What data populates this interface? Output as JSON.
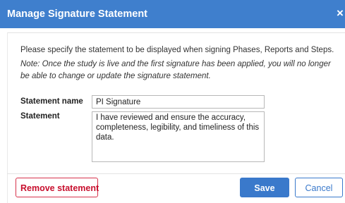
{
  "dialog": {
    "title": "Manage Signature Statement",
    "close_icon": "×"
  },
  "intro": "Please specify the statement to be displayed when signing Phases, Reports and Steps.",
  "note": "Note: Once the study is live and the first signature has been applied, you will no longer be able to change or update the signature statement.",
  "form": {
    "statement_name_label": "Statement name",
    "statement_name_value": "PI Signature",
    "statement_label": "Statement",
    "statement_value": "I have reviewed and ensure the accuracy, completeness, legibility, and timeliness of this data."
  },
  "buttons": {
    "remove": "Remove statement",
    "save": "Save",
    "cancel": "Cancel"
  },
  "colors": {
    "header": "#3f7fcd",
    "primary": "#3a79cb",
    "danger": "#c8102e"
  }
}
